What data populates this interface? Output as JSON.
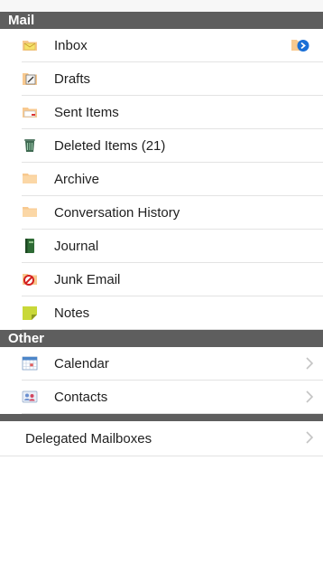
{
  "mail": {
    "header": "Mail",
    "items": [
      {
        "label": "Inbox",
        "icon": "inbox-folder-icon"
      },
      {
        "label": "Drafts",
        "icon": "drafts-folder-icon"
      },
      {
        "label": "Sent Items",
        "icon": "sent-folder-icon"
      },
      {
        "label": "Deleted Items (21)",
        "icon": "trash-can-icon"
      },
      {
        "label": "Archive",
        "icon": "folder-icon"
      },
      {
        "label": "Conversation History",
        "icon": "folder-icon"
      },
      {
        "label": "Journal",
        "icon": "journal-book-icon"
      },
      {
        "label": "Junk Email",
        "icon": "junk-folder-icon"
      },
      {
        "label": "Notes",
        "icon": "note-icon"
      }
    ]
  },
  "other": {
    "header": "Other",
    "items": [
      {
        "label": "Calendar",
        "icon": "calendar-icon"
      },
      {
        "label": "Contacts",
        "icon": "contacts-card-icon"
      }
    ]
  },
  "delegated": {
    "label": "Delegated Mailboxes"
  },
  "colors": {
    "header_bg": "#5e5e5e",
    "folder_tan": "#f8c98f",
    "accent_blue": "#1a6fd6"
  }
}
